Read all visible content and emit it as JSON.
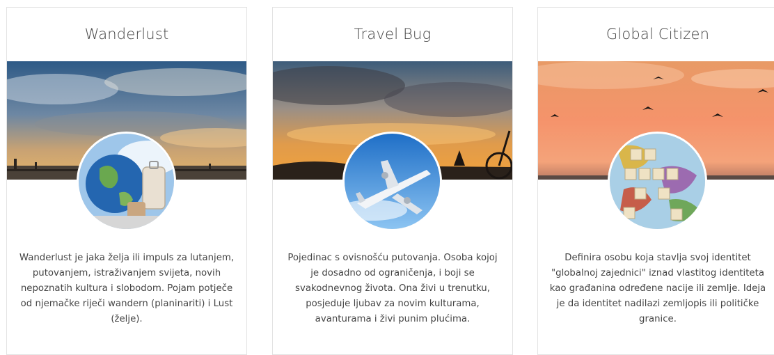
{
  "cards": [
    {
      "title": "Wanderlust",
      "banner_icon": "sunset-pier-image",
      "avatar_icon": "globe-luggage-image",
      "description": "Wanderlust je jaka želja ili impuls za lutanjem, putovanjem, istraživanjem svijeta, novih nepoznatih kultura i slobodom. Pojam potječe od njemačke riječi wandern (planinariti) i Lust (želje)."
    },
    {
      "title": "Travel Bug",
      "banner_icon": "sunset-clouds-bicycle-image",
      "avatar_icon": "airplane-image",
      "description": "Pojedinac s ovisnošću putovanja. Osoba kojoj je dosadno od ograničenja, i boji se svakodnevnog života. Ona živi u trenutku, posjeduje ljubav za novim kulturama, avanturama i živi punim plućima."
    },
    {
      "title": "Global Citizen",
      "banner_icon": "sunset-birds-image",
      "avatar_icon": "map-scrabble-tiles-image",
      "description": "Definira osobu koja stavlja svoj identitet \"globalnoj zajednici\" iznad vlastitog identiteta kao građanina određene nacije ili zemlje. Ideja je da identitet nadilazi zemljopis ili političke granice."
    }
  ]
}
